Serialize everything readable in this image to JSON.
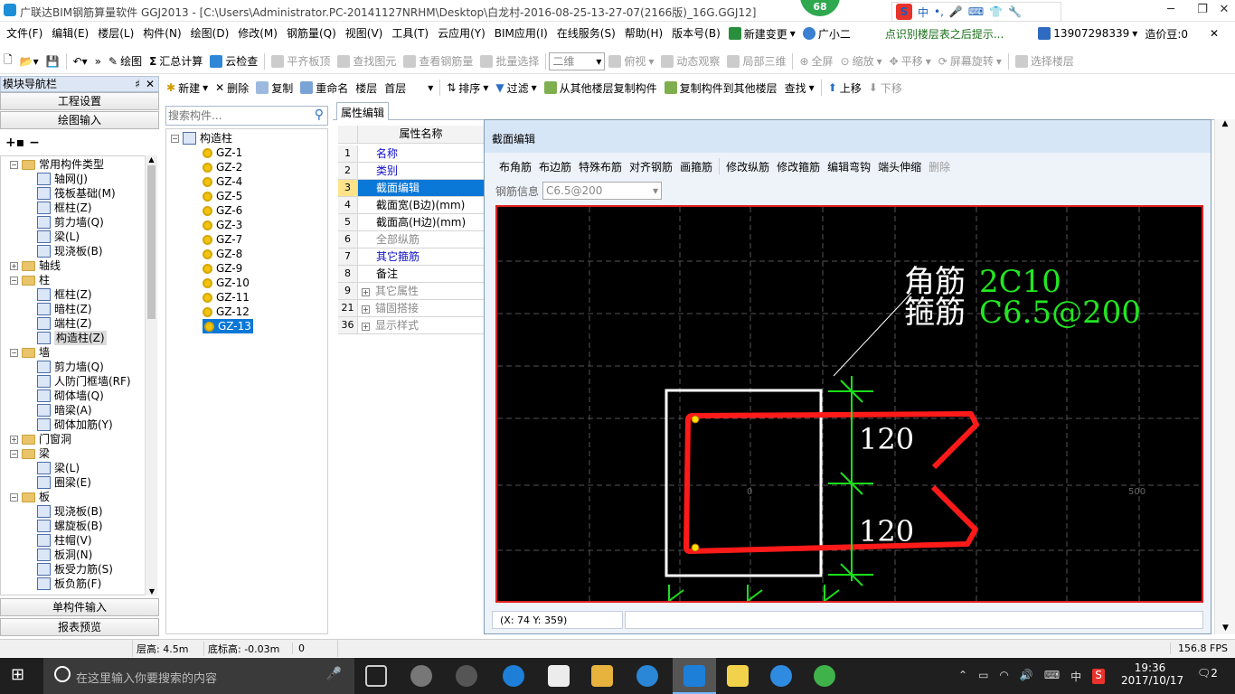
{
  "titlebar": {
    "title": "广联达BIM钢筋算量软件 GGJ2013 - [C:\\Users\\Administrator.PC-20141127NRHM\\Desktop\\白龙村-2016-08-25-13-27-07(2166版)_16G.GGJ12]",
    "badge": "68",
    "ime_label": "中",
    "ime_extra": "•,",
    "min": "─",
    "max": "❐",
    "close": "✕"
  },
  "menubar": {
    "items": [
      "文件(F)",
      "编辑(E)",
      "楼层(L)",
      "构件(N)",
      "绘图(D)",
      "修改(M)",
      "钢筋量(Q)",
      "视图(V)",
      "工具(T)",
      "云应用(Y)",
      "BIM应用(I)",
      "在线服务(S)",
      "帮助(H)",
      "版本号(B)"
    ],
    "new_change": "新建变更",
    "guangxiaoer": "广小二",
    "hint": "点识别楼层表之后提示...",
    "phone": "13907298339",
    "coins": "造价豆:0"
  },
  "toolbar1": {
    "draw": "绘图",
    "sum": "汇总计算",
    "cloud_check": "云检查",
    "flush_slab": "平齐板顶",
    "find_elem": "查找图元",
    "view_rebar": "查看钢筋量",
    "batch_select": "批量选择",
    "view_mode": "二维",
    "top_view": "俯视",
    "dynamic_view": "动态观察",
    "local_3d": "局部三维",
    "fullscreen": "全屏",
    "zoom": "缩放",
    "pan": "平移",
    "rotate": "屏幕旋转",
    "select_floor": "选择楼层"
  },
  "toolbar2": {
    "new": "新建",
    "delete": "删除",
    "copy": "复制",
    "rename": "重命名",
    "floor_label": "楼层",
    "floor_value": "首层",
    "sort": "排序",
    "filter": "过滤",
    "copy_from": "从其他楼层复制构件",
    "copy_to": "复制构件到其他楼层",
    "find": "查找",
    "up": "上移",
    "down": "下移"
  },
  "nav": {
    "title": "模块导航栏",
    "pin": "♯",
    "close": "✕",
    "project_settings": "工程设置",
    "drawing_input": "绘图输入",
    "single_input": "单构件输入",
    "report_preview": "报表预览",
    "tree": [
      {
        "label": "常用构件类型",
        "level": 0,
        "type": "folder",
        "exp": "−"
      },
      {
        "label": "轴网(J)",
        "level": 1,
        "type": "item"
      },
      {
        "label": "筏板基础(M)",
        "level": 1,
        "type": "item"
      },
      {
        "label": "框柱(Z)",
        "level": 1,
        "type": "item"
      },
      {
        "label": "剪力墙(Q)",
        "level": 1,
        "type": "item"
      },
      {
        "label": "梁(L)",
        "level": 1,
        "type": "item"
      },
      {
        "label": "现浇板(B)",
        "level": 1,
        "type": "item"
      },
      {
        "label": "轴线",
        "level": 0,
        "type": "folder",
        "exp": "+"
      },
      {
        "label": "柱",
        "level": 0,
        "type": "folder",
        "exp": "−"
      },
      {
        "label": "框柱(Z)",
        "level": 1,
        "type": "item"
      },
      {
        "label": "暗柱(Z)",
        "level": 1,
        "type": "item"
      },
      {
        "label": "端柱(Z)",
        "level": 1,
        "type": "item"
      },
      {
        "label": "构造柱(Z)",
        "level": 1,
        "type": "item",
        "selected": true
      },
      {
        "label": "墙",
        "level": 0,
        "type": "folder",
        "exp": "−"
      },
      {
        "label": "剪力墙(Q)",
        "level": 1,
        "type": "item"
      },
      {
        "label": "人防门框墙(RF)",
        "level": 1,
        "type": "item"
      },
      {
        "label": "砌体墙(Q)",
        "level": 1,
        "type": "item"
      },
      {
        "label": "暗梁(A)",
        "level": 1,
        "type": "item"
      },
      {
        "label": "砌体加筋(Y)",
        "level": 1,
        "type": "item"
      },
      {
        "label": "门窗洞",
        "level": 0,
        "type": "folder",
        "exp": "+"
      },
      {
        "label": "梁",
        "level": 0,
        "type": "folder",
        "exp": "−"
      },
      {
        "label": "梁(L)",
        "level": 1,
        "type": "item"
      },
      {
        "label": "圈梁(E)",
        "level": 1,
        "type": "item"
      },
      {
        "label": "板",
        "level": 0,
        "type": "folder",
        "exp": "−"
      },
      {
        "label": "现浇板(B)",
        "level": 1,
        "type": "item"
      },
      {
        "label": "螺旋板(B)",
        "level": 1,
        "type": "item"
      },
      {
        "label": "柱帽(V)",
        "level": 1,
        "type": "item"
      },
      {
        "label": "板洞(N)",
        "level": 1,
        "type": "item"
      },
      {
        "label": "板受力筋(S)",
        "level": 1,
        "type": "item"
      },
      {
        "label": "板负筋(F)",
        "level": 1,
        "type": "item"
      }
    ]
  },
  "components": {
    "search_placeholder": "搜索构件...",
    "root": "构造柱",
    "items": [
      "GZ-1",
      "GZ-2",
      "GZ-4",
      "GZ-5",
      "GZ-6",
      "GZ-3",
      "GZ-7",
      "GZ-8",
      "GZ-9",
      "GZ-10",
      "GZ-11",
      "GZ-12",
      "GZ-13"
    ],
    "selected": "GZ-13"
  },
  "props": {
    "tab": "属性编辑",
    "header": "属性名称",
    "rows": [
      {
        "num": "1",
        "name": "名称",
        "style": "blue"
      },
      {
        "num": "2",
        "name": "类别",
        "style": "blue"
      },
      {
        "num": "3",
        "name": "截面编辑",
        "style": "selected"
      },
      {
        "num": "4",
        "name": "截面宽(B边)(mm)",
        "style": "normal"
      },
      {
        "num": "5",
        "name": "截面高(H边)(mm)",
        "style": "normal"
      },
      {
        "num": "6",
        "name": "全部纵筋",
        "style": "grey"
      },
      {
        "num": "7",
        "name": "其它箍筋",
        "style": "blue"
      },
      {
        "num": "8",
        "name": "备注",
        "style": "normal"
      },
      {
        "num": "9",
        "name": "其它属性",
        "style": "grey",
        "plus": true
      },
      {
        "num": "21",
        "name": "锚固搭接",
        "style": "grey",
        "plus": true
      },
      {
        "num": "36",
        "name": "显示样式",
        "style": "grey",
        "plus": true
      }
    ]
  },
  "section": {
    "title": "截面编辑",
    "tools": [
      "布角筋",
      "布边筋",
      "特殊布筋",
      "对齐钢筋",
      "画箍筋",
      "修改纵筋",
      "修改箍筋",
      "编辑弯钩",
      "端头伸缩",
      "删除"
    ],
    "rebar_info_label": "钢筋信息",
    "rebar_info_value": "C6.5@200",
    "corner_label": "角筋",
    "corner_value": "2C10",
    "stirrup_label": "箍筋",
    "stirrup_value": "C6.5@200",
    "dim_top": "120",
    "dim_bottom": "120",
    "axis_zero": "0",
    "axis_500": "500",
    "coords": "(X: 74 Y: 359)"
  },
  "status": {
    "floor_height": "层高: 4.5m",
    "base_height": "底标高: -0.03m",
    "value": "0",
    "fps": "156.8 FPS"
  },
  "taskbar": {
    "search_placeholder": "在这里输入你要搜索的内容",
    "ime": "中",
    "time": "19:36",
    "date": "2017/10/17",
    "notify_count": "2"
  },
  "colors": {
    "canvas_bg": "#000000",
    "rebar_red": "#ff1a1a",
    "dim_green": "#1adf1a",
    "text_green": "#22e622",
    "selection_blue": "#0a78d7"
  }
}
